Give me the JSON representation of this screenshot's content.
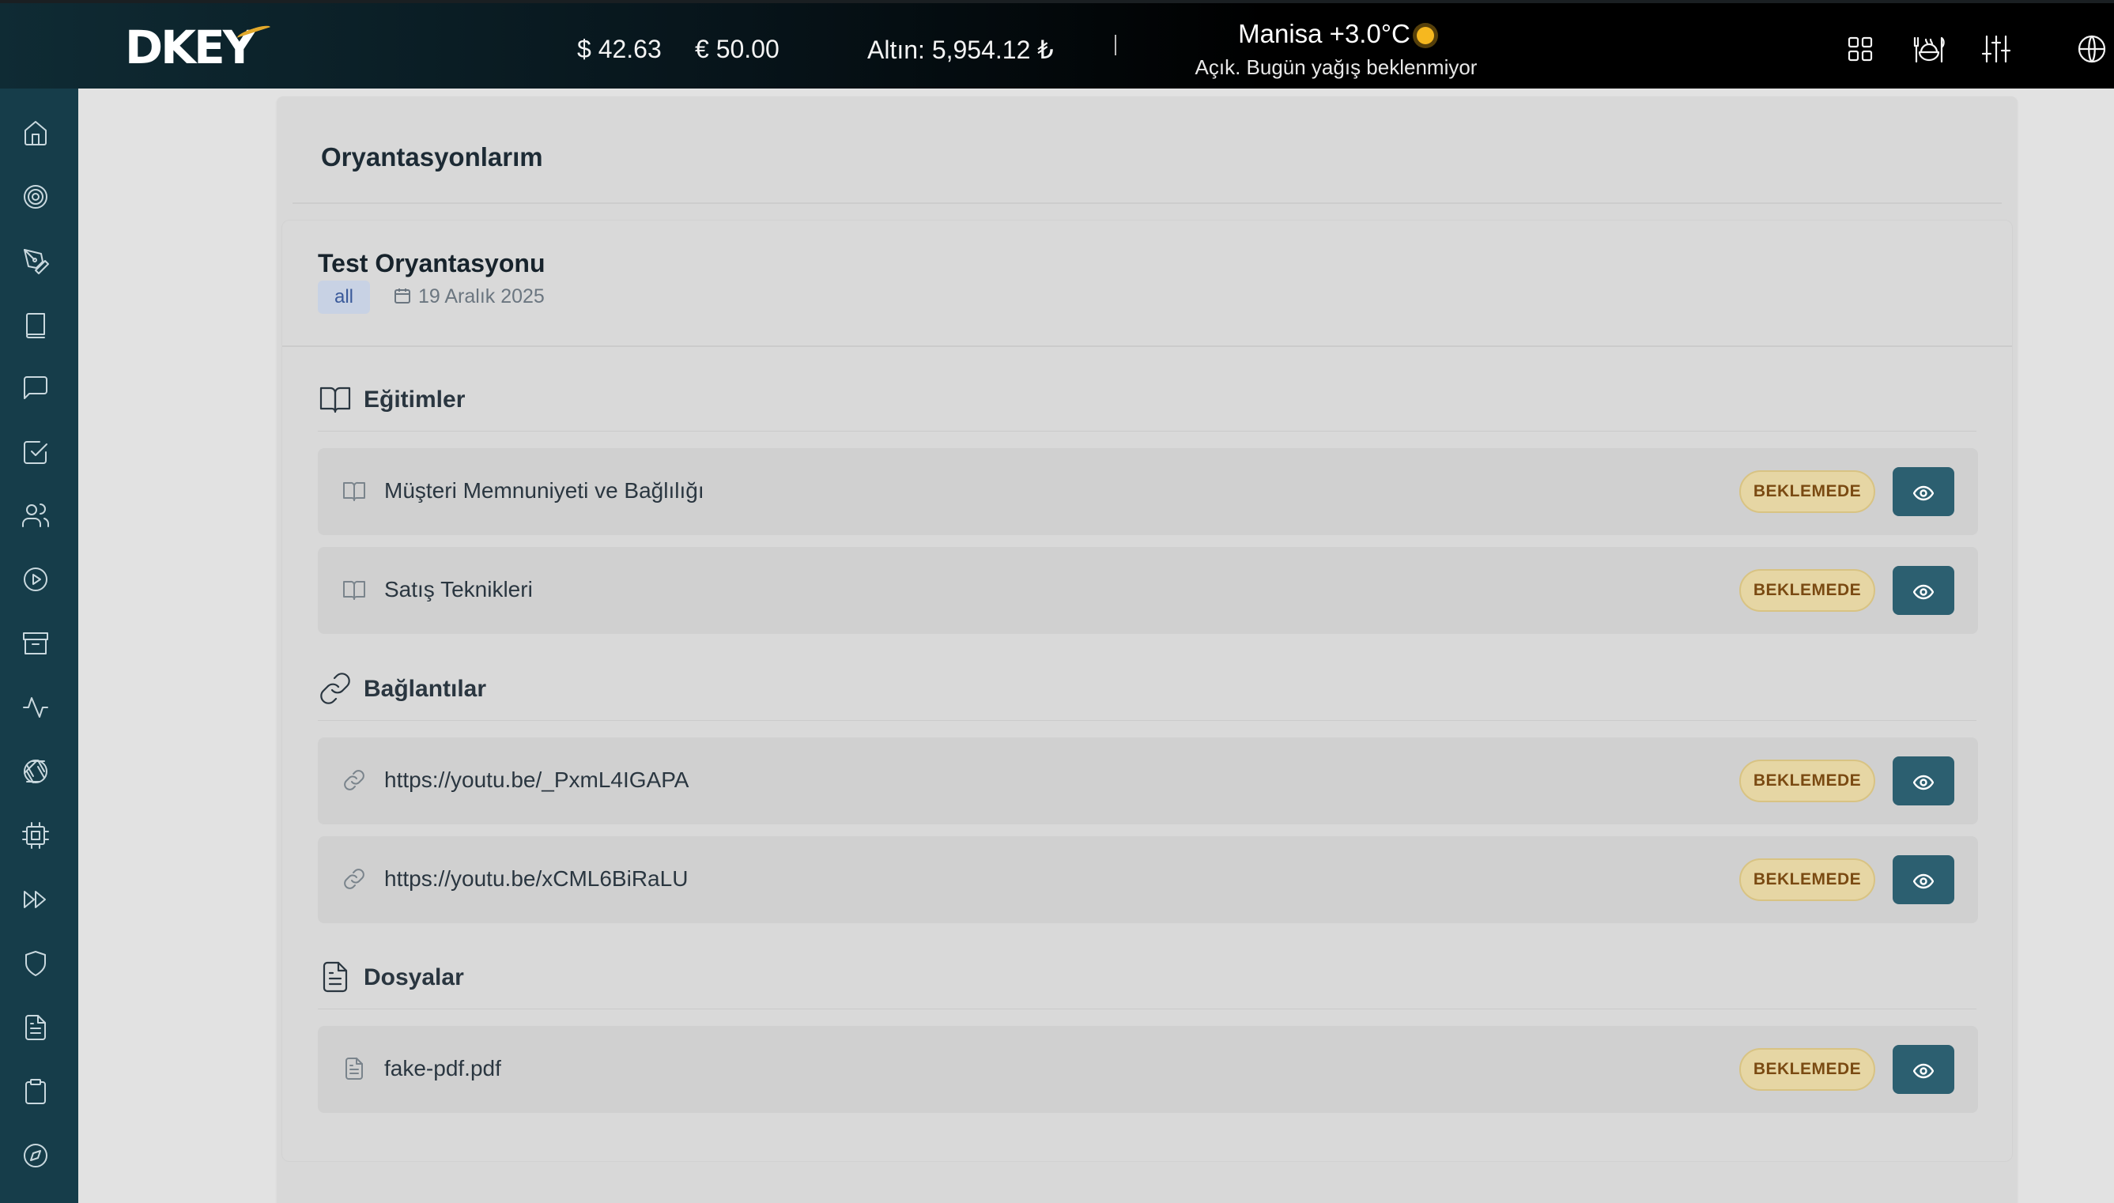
{
  "header": {
    "logo": "DKEY",
    "usd": "$ 42.63",
    "eur": "€ 50.00",
    "gold": "Altın: 5,954.12 ₺",
    "weather_title": "Manisa +3.0°C",
    "weather_desc": "Açık. Bugün yağış beklenmiyor",
    "icons": [
      "grid-icon",
      "food-icon",
      "sliders-icon",
      "globe-icon"
    ]
  },
  "sidebar": {
    "items": [
      "home-icon",
      "target-icon",
      "pen-tool-icon",
      "book-icon",
      "message-icon",
      "check-square-icon",
      "users-icon",
      "play-circle-icon",
      "archive-icon",
      "activity-icon",
      "aperture-icon",
      "cpu-icon",
      "fast-forward-icon",
      "shield-icon",
      "file-text-icon",
      "clipboard-icon",
      "compass-icon"
    ]
  },
  "page": {
    "title": "Oryantasyonlarım"
  },
  "orientation": {
    "title": "Test Oryantasyonu",
    "badge": "all",
    "date": "19 Aralık 2025"
  },
  "sections": {
    "trainings": {
      "title": "Eğitimler",
      "items": [
        {
          "label": "Müşteri Memnuniyeti ve Bağlılığı",
          "status": "BEKLEMEDE"
        },
        {
          "label": "Satış Teknikleri",
          "status": "BEKLEMEDE"
        }
      ]
    },
    "links": {
      "title": "Bağlantılar",
      "items": [
        {
          "label": "https://youtu.be/_PxmL4IGAPA",
          "status": "BEKLEMEDE"
        },
        {
          "label": "https://youtu.be/xCML6BiRaLU",
          "status": "BEKLEMEDE"
        }
      ]
    },
    "files": {
      "title": "Dosyalar",
      "items": [
        {
          "label": "fake-pdf.pdf",
          "status": "BEKLEMEDE"
        }
      ]
    }
  },
  "colors": {
    "sidebar": "#163d4a",
    "primary_button": "#2c5f70",
    "status_bg": "#e6d6a4",
    "status_text": "#7a4a12",
    "badge_bg": "#c8d2e4"
  }
}
